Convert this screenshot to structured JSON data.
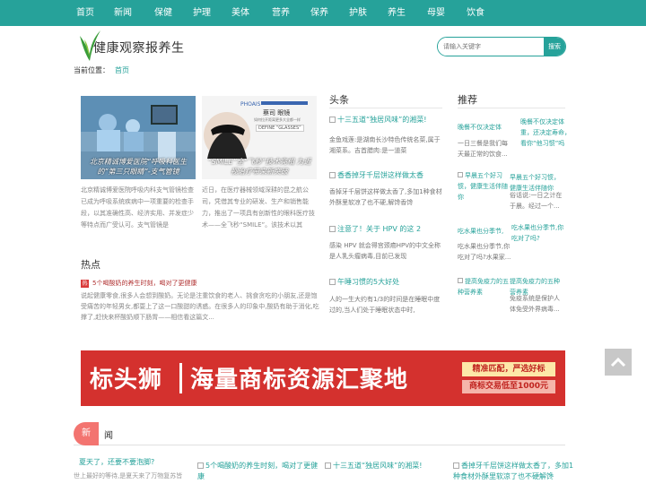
{
  "nav": [
    "首页",
    "新闻",
    "保健",
    "护理",
    "美体",
    "营养",
    "保养",
    "护肤",
    "养生",
    "母婴",
    "饮食"
  ],
  "site": {
    "logo_text": "健康观察报养生"
  },
  "search": {
    "placeholder": "请输入关键字",
    "button": "搜索"
  },
  "breadcrumb": {
    "label": "当前位置：",
    "home": "首页"
  },
  "slides": [
    {
      "caption": "北京精诚博爱医院“呼吸科医生的”第三只眼睛”-支气管镜",
      "summary": "北京精诚博爱医院呼吸内科支气管镜检查已成为呼吸系统疾病中一项重要的检查手段，以其准确性高、经济实用、并发症少等特点而广受认可。支气管镜是"
    },
    {
      "caption": "“SMILE”全“飞秒”技术亮相 为近视治疗带来新突破",
      "summary": "近日，在医疗器械领域深耕的昆之航公司，凭借其专业的研发、生产和销售能力，推出了一项具有创新性的眼科医疗技术——全飞秒“SMILE”。该技术以其"
    }
  ],
  "slide_sign": {
    "brand": "PHOAIS",
    "title": "蔡司 眼镜",
    "sub": "如何拉开距离更多大全都一样",
    "quote": "DEFINE “GLASSES”"
  },
  "sections": {
    "hot": "热点",
    "headline": "头条",
    "recommend": "推荐",
    "news_head1": "新",
    "news_head2": "闻"
  },
  "hot": {
    "badge": "热",
    "title": "5个喝酸奶的养生时刻，喝对了更健康",
    "text": "说起健康零食,很多人会想到酸奶。无论是注重饮食的老人、挑食贪吃的小朋友,还是饱受痛苦的年轻男女,都耍上了这一口酸甜的诱惑。在很多人的印象中,酸奶有助于消化,吃撑了,赶快来杯酸奶顺下肠胃——相信看这篇文..."
  },
  "headlines": [
    {
      "title": "十三五道“独居风味”的湘菜!",
      "summary": "金鱼戏莲:是湖南长沙特色传统名菜,属于湘菜系。吉首腊肉:是一道菜"
    },
    {
      "title": "香香掉牙千层饼这样做太香",
      "summary": "香掉牙千层饼这样做太香了,多加1种食材外酥里软凉了也不硬,解馋香馋"
    },
    {
      "title": "注意了！关于 HPV 的这 2",
      "summary": "感染 HPV 就会得宫颈癌HPV的中文全称是人乳头瘤病毒,目前已发现"
    },
    {
      "title": "午睡习惯的5大好处",
      "summary": "人的一生大约有1/3的时间是在睡眠中度过的,当人们处于睡眠状态中时,"
    }
  ],
  "recommend": [
    {
      "title": "晚餐不仅决定体",
      "summary": "一日三餐是我们每天最正常的饮食..."
    },
    {
      "title": "晚餐不仅决定体重，还决定寿命，看你“他习惯”吗",
      "summary": "…"
    },
    {
      "title": "早晨五个好习惯，健康生活伴随你",
      "summary": "俗话说:一日之计在于晨。经过一个..."
    },
    {
      "title": "吃水果也分季节,",
      "summary": "吃水果也分季节,你吃对了吗?水果家..."
    },
    {
      "title": "提高免疫力的五种营养素",
      "summary": "免疫系统是保护人体免受外界病毒..."
    }
  ],
  "recommend_dup": [
    "晚餐不仅决定体重，还决定寿命，看你“他习惯”吗",
    "早晨五个好习惯，健康生活伴随你",
    "吃水果也分季节,你吃对了吗?",
    "提高免疫力的五种营养素"
  ],
  "banner": {
    "brand": "标头狮",
    "slogan": "海量商标资源汇聚地",
    "tag1": "精准匹配，严选好标",
    "tag2": "商标交易低至1000元"
  },
  "news": [
    {
      "title": "夏天了，还要不要泡脚?",
      "summary": "世上最好的等待,是夏天来了万物复苏皆"
    },
    {
      "title": "5个喝酸奶的养生时刻，喝对了更健康",
      "summary": ""
    },
    {
      "title": "十三五道“独居风味”的湘菜!",
      "summary": ""
    },
    {
      "title": "香掉牙千层饼这样做太香了，多加1种食材外酥里软凉了也不硬解馋",
      "summary": ""
    }
  ],
  "colors": {
    "theme": "#26a29a",
    "banner": "#d4312e",
    "hot_badge": "#f37470"
  }
}
